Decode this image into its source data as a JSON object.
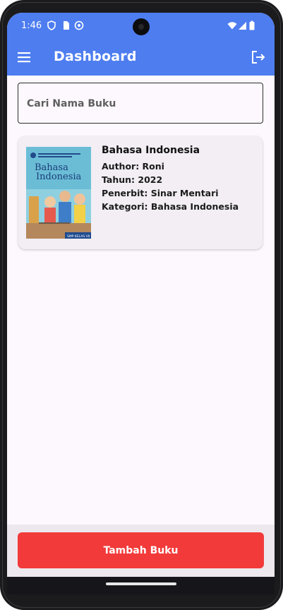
{
  "status_bar": {
    "time": "1:46",
    "left_icons": [
      "shield-icon",
      "sim-card-icon",
      "face-icon"
    ],
    "right_icons": [
      "wifi-icon",
      "signal-icon",
      "battery-icon"
    ]
  },
  "app_bar": {
    "title": "Dashboard",
    "menu_icon": "hamburger-menu-icon",
    "action_icon": "logout-icon",
    "color": "#4e7df0"
  },
  "search": {
    "placeholder": "Cari Nama Buku",
    "value": ""
  },
  "books": [
    {
      "title": "Bahasa Indonesia",
      "author": "Author: Roni",
      "year": "Tahun: 2022",
      "publisher": "Penerbit: Sinar Mentari",
      "category": "Kategori: Bahasa Indonesia",
      "cover": {
        "title_line1": "Bahasa",
        "title_line2": "Indonesia",
        "badge": "SMP KELAS VII"
      }
    }
  ],
  "add_button": {
    "label": "Tambah Buku",
    "color": "#f23a3a"
  }
}
